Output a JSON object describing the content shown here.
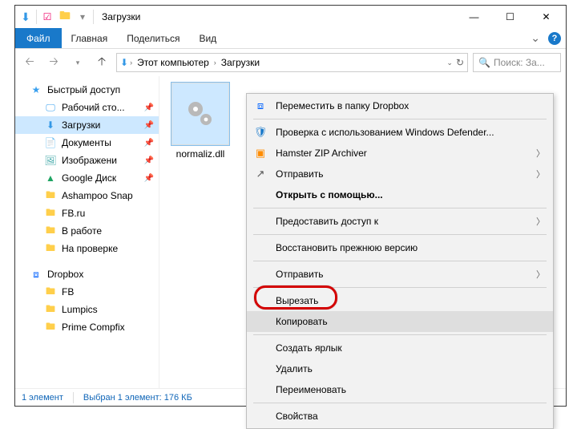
{
  "titlebar": {
    "title": "Загрузки"
  },
  "ribbon": {
    "file": "Файл",
    "tabs": [
      "Главная",
      "Поделиться",
      "Вид"
    ]
  },
  "address": {
    "root": "Этот компьютер",
    "current": "Загрузки"
  },
  "search": {
    "placeholder": "Поиск: За..."
  },
  "sidebar": {
    "quick": {
      "label": "Быстрый доступ",
      "items": [
        {
          "label": "Рабочий сто...",
          "icon": "desktop",
          "pinned": true
        },
        {
          "label": "Загрузки",
          "icon": "downloads",
          "pinned": true,
          "selected": true
        },
        {
          "label": "Документы",
          "icon": "documents",
          "pinned": true
        },
        {
          "label": "Изображени",
          "icon": "pictures",
          "pinned": true
        },
        {
          "label": "Google Диск",
          "icon": "gdrive",
          "pinned": true
        },
        {
          "label": "Ashampoo Snap",
          "icon": "folder"
        },
        {
          "label": "FB.ru",
          "icon": "folder"
        },
        {
          "label": "В работе",
          "icon": "folder"
        },
        {
          "label": "На проверке",
          "icon": "folder"
        }
      ]
    },
    "dropbox": {
      "label": "Dropbox",
      "items": [
        {
          "label": "FB",
          "icon": "folder"
        },
        {
          "label": "Lumpics",
          "icon": "folder"
        },
        {
          "label": "Prime Compfix",
          "icon": "folder"
        }
      ]
    }
  },
  "file": {
    "name": "normaliz.dll"
  },
  "context_menu": {
    "items": [
      {
        "label": "Переместить в папку Dropbox",
        "icon": "dropbox"
      },
      {
        "sep": true
      },
      {
        "label": "Проверка с использованием Windows Defender...",
        "icon": "shield"
      },
      {
        "label": "Hamster ZIP Archiver",
        "icon": "hamster",
        "submenu": true
      },
      {
        "label": "Отправить",
        "icon": "share",
        "submenu": true
      },
      {
        "label": "Открыть с помощью...",
        "bold": true
      },
      {
        "sep": true
      },
      {
        "label": "Предоставить доступ к",
        "submenu": true
      },
      {
        "sep": true
      },
      {
        "label": "Восстановить прежнюю версию"
      },
      {
        "sep": true
      },
      {
        "label": "Отправить",
        "submenu": true
      },
      {
        "sep": true
      },
      {
        "label": "Вырезать"
      },
      {
        "label": "Копировать",
        "highlight": true
      },
      {
        "sep": true
      },
      {
        "label": "Создать ярлык"
      },
      {
        "label": "Удалить"
      },
      {
        "label": "Переименовать"
      },
      {
        "sep": true
      },
      {
        "label": "Свойства"
      }
    ]
  },
  "status": {
    "count": "1 элемент",
    "selection": "Выбран 1 элемент: 176 КБ"
  }
}
